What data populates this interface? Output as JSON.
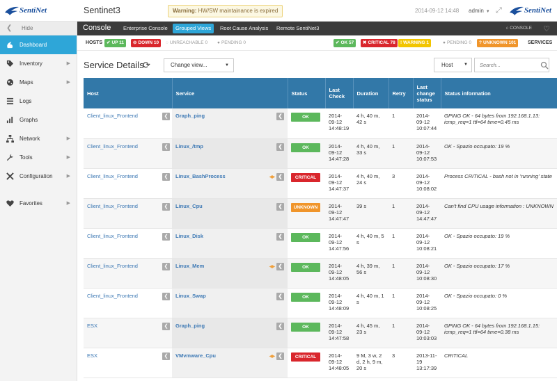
{
  "brand": {
    "name": "SentiNet"
  },
  "app": {
    "title": "Sentinet3"
  },
  "warning": {
    "label": "Warning:",
    "text": "HW/SW maintainance is expired"
  },
  "header": {
    "datetime": "2014-09-12 14:48",
    "user": "admin"
  },
  "sidebar": {
    "hide_label": "Hide",
    "items": [
      {
        "label": "Dashboard",
        "icon": "dashboard-icon",
        "active": true
      },
      {
        "label": "Inventory",
        "icon": "tag-icon"
      },
      {
        "label": "Maps",
        "icon": "globe-icon"
      },
      {
        "label": "Logs",
        "icon": "list-icon"
      },
      {
        "label": "Graphs",
        "icon": "bar-chart-icon"
      },
      {
        "label": "Network",
        "icon": "network-icon"
      },
      {
        "label": "Tools",
        "icon": "wrench-icon"
      },
      {
        "label": "Configuration",
        "icon": "tools-icon"
      },
      {
        "label": "Favorites",
        "icon": "heart-icon"
      }
    ]
  },
  "console": {
    "title": "Console",
    "tabs": [
      {
        "label": "Enterprise Console"
      },
      {
        "label": "Grouped Views",
        "active": true
      },
      {
        "label": "Root Cause Analysis"
      },
      {
        "label": "Remote SentiNet3"
      }
    ],
    "breadcrumb": "CONSOLE"
  },
  "status_bar": {
    "hosts_label": "HOSTS",
    "hosts": [
      {
        "label": "UP 11",
        "color": "#5cb85c"
      },
      {
        "label": "DOWN 10",
        "color": "#d9262c"
      },
      {
        "label": "UNREACHABLE 0",
        "color": ""
      },
      {
        "label": "PENDING 0",
        "color": ""
      }
    ],
    "services": [
      {
        "label": "OK 57",
        "color": "#5cb85c"
      },
      {
        "label": "CRITICAL 78",
        "color": "#d9262c"
      },
      {
        "label": "WARNING 1",
        "color": "#f2c500"
      },
      {
        "label": "PENDING 0",
        "color": ""
      },
      {
        "label": "UNKNOWN 101",
        "color": "#f0952b"
      }
    ],
    "services_label": "SERVICES"
  },
  "section": {
    "title": "Service Details"
  },
  "controls": {
    "change_view": "Change view...",
    "host_filter": "Host",
    "search_placeholder": "Search..."
  },
  "table": {
    "columns": [
      "Host",
      "Service",
      "Status",
      "Last Check",
      "Duration",
      "Retry",
      "Last change status",
      "Status information"
    ],
    "rows": [
      {
        "host": "Client_linux_Frontend",
        "service": "Graph_ping",
        "status": "OK",
        "last_check": "2014-09-12 14:48:19",
        "duration": "4 h, 40 m, 42 s",
        "retry": "1",
        "last_change": "2014-09-12 10:07:44",
        "info": "GPING OK - 64 bytes from 192.168.1.13: icmp_req=1 ttl=64 time=0.45 ms",
        "flag": false
      },
      {
        "host": "Client_linux_Frontend",
        "service": "Linux_/tmp",
        "status": "OK",
        "last_check": "2014-09-12 14:47:28",
        "duration": "4 h, 40 m, 33 s",
        "retry": "1",
        "last_change": "2014-09-12 10:07:53",
        "info": "OK - Spazio occupato: 19 %",
        "flag": false
      },
      {
        "host": "Client_linux_Frontend",
        "service": "Linux_BashProcess",
        "status": "CRITICAL",
        "last_check": "2014-09-12 14:47:37",
        "duration": "4 h, 40 m, 24 s",
        "retry": "3",
        "last_change": "2014-09-12 10:08:02",
        "info": "Process CRITICAL - bash not in 'running' state",
        "flag": true
      },
      {
        "host": "Client_linux_Frontend",
        "service": "Linux_Cpu",
        "status": "UNKNOWN",
        "last_check": "2014-09-12 14:47:47",
        "duration": "39 s",
        "retry": "1",
        "last_change": "2014-09-12 14:47:47",
        "info": "Can't find CPU usage information : UNKNOWN",
        "flag": false
      },
      {
        "host": "Client_linux_Frontend",
        "service": "Linux_Disk",
        "status": "OK",
        "last_check": "2014-09-12 14:47:56",
        "duration": "4 h, 40 m, 5 s",
        "retry": "1",
        "last_change": "2014-09-12 10:08:21",
        "info": "OK - Spazio occupato: 19 %",
        "flag": false
      },
      {
        "host": "Client_linux_Frontend",
        "service": "Linux_Mem",
        "status": "OK",
        "last_check": "2014-09-12 14:48:05",
        "duration": "4 h, 39 m, 56 s",
        "retry": "1",
        "last_change": "2014-09-12 10:08:30",
        "info": "OK - Spazio occupato: 17 %",
        "flag": true
      },
      {
        "host": "Client_linux_Frontend",
        "service": "Linux_Swap",
        "status": "OK",
        "last_check": "2014-09-12 14:48:09",
        "duration": "4 h, 40 m, 1 s",
        "retry": "1",
        "last_change": "2014-09-12 10:08:25",
        "info": "OK - Spazio occupato: 0 %",
        "flag": false
      },
      {
        "host": "ESX",
        "service": "Graph_ping",
        "status": "OK",
        "last_check": "2014-09-12 14:47:58",
        "duration": "4 h, 45 m, 23 s",
        "retry": "1",
        "last_change": "2014-09-12 10:03:03",
        "info": "GPING OK - 64 bytes from 192.168.1.15: icmp_req=1 ttl=64 time=0.38 ms",
        "flag": false
      },
      {
        "host": "ESX",
        "service": "VMvmware_Cpu",
        "status": "CRITICAL",
        "last_check": "2014-09-12 14:48:05",
        "duration": "9 M, 3 w, 2 d, 2 h, 9 m, 20 s",
        "retry": "3",
        "last_change": "2013-11-19 13:17:39",
        "info": "CRITICAL",
        "flag": true
      }
    ]
  }
}
